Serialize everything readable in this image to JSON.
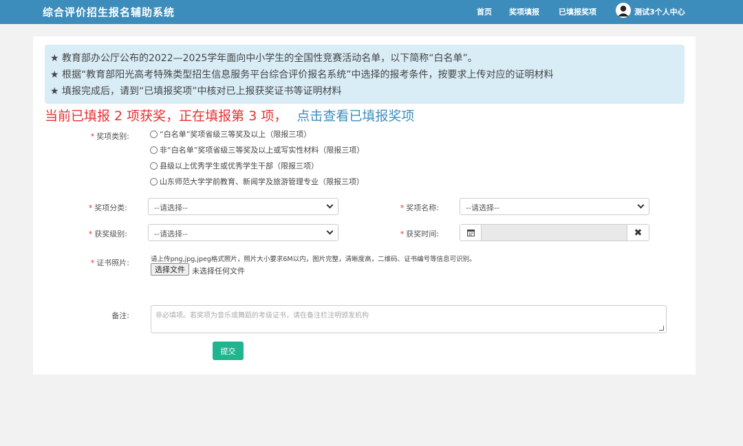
{
  "app": {
    "title": "综合评价招生报名辅助系统"
  },
  "nav": {
    "items": [
      "首页",
      "奖项填报",
      "已填报奖项"
    ],
    "user_label": "测试3个人中心"
  },
  "notice": {
    "lines": [
      "★ 教育部办公厅公布的2022—2025学年面向中小学生的全国性竞赛活动名单，以下简称“白名单”。",
      "★ 根据“教育部阳光高考特殊类型招生信息服务平台综合评价报名系统”中选择的报考条件，按要求上传对应的证明材料",
      "★ 填报完成后，请到“已填报奖项”中核对已上报获奖证书等证明材料"
    ]
  },
  "status": {
    "text": "当前已填报 2 项获奖，正在填报第 3 项，",
    "link": "点击查看已填报奖项"
  },
  "form": {
    "award_type_label": "奖项类别:",
    "award_type_options": [
      "“白名单”奖项省级三等奖及以上（限报三项）",
      "非“白名单”奖项省级三等奖及以上或写实性材料（限报三项）",
      "县级以上优秀学生或优秀学生干部（限报三项）",
      "山东师范大学学前教育、新闻学及旅游管理专业（限报三项）"
    ],
    "category_label": "奖项分类:",
    "category_value": "--请选择--",
    "name_label": "奖项名称:",
    "name_value": "--请选择--",
    "level_label": "获奖级别:",
    "level_value": "--请选择--",
    "time_label": "获奖时间:",
    "photo_label": "证书照片:",
    "photo_hint": "请上传png,jpg,jpeg格式照片，照片大小要求6M以内，图片完整，清晰度高，二维码、证书编号等信息可识别。",
    "file_button": "选择文件",
    "file_status": "未选择任何文件",
    "remark_label": "备注:",
    "remark_placeholder": "非必填项。若奖项为音乐或舞蹈的考级证书，请在备注栏注明颁发机构",
    "submit_label": "提交",
    "required_mark": "*"
  },
  "icons": {
    "calendar": "calendar-icon",
    "clear": "close-icon",
    "avatar": "user-avatar-icon"
  },
  "colors": {
    "topbar": "#3c8dbc",
    "notice_bg": "#d9edf7",
    "status_red": "#e62e2e",
    "link_blue": "#3c8dbc",
    "submit": "#1fb58f"
  }
}
